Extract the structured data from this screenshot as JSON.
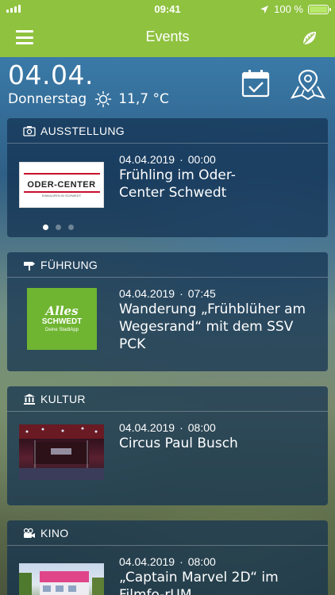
{
  "status_bar": {
    "time": "09:41",
    "battery": "100 %"
  },
  "nav": {
    "title": "Events",
    "menu_icon": "hamburger-icon",
    "theme_icon": "leaf-icon"
  },
  "today": {
    "date": "04.04.",
    "weekday": "Donnerstag",
    "temperature": "11,7 °C",
    "weather_icon": "sun-icon"
  },
  "actions": {
    "calendar_icon": "calendar-check-icon",
    "map_icon": "map-pin-icon"
  },
  "colors": {
    "brand_green": "#8fc23f",
    "card_bg": "#123050"
  },
  "events": [
    {
      "category": "AUSSTELLUNG",
      "icon": "camera-icon",
      "date": "04.04.2019",
      "time": "00:00",
      "title": "Frühling im Oder-Center Schwedt",
      "logo_text": "ODER-CENTER",
      "logo_sub": "EINKAUFEN IN SCHWEDT",
      "pager": {
        "count": 3,
        "active": 1
      }
    },
    {
      "category": "FÜHRUNG",
      "icon": "signpost-icon",
      "date": "04.04.2019",
      "time": "07:45",
      "title": "Wanderung „Frühblüher am Wegesrand“ mit dem SSV PCK",
      "logo_text": "Alles",
      "logo_text2": "SCHWEDT",
      "logo_sub": "Deine StadtApp"
    },
    {
      "category": "KULTUR",
      "icon": "museum-icon",
      "date": "04.04.2019",
      "time": "08:00",
      "title": "Circus Paul Busch"
    },
    {
      "category": "KINO",
      "icon": "film-camera-icon",
      "date": "04.04.2019",
      "time": "08:00",
      "title": "„Captain Marvel 2D“ im Filmfo-rUM"
    }
  ]
}
